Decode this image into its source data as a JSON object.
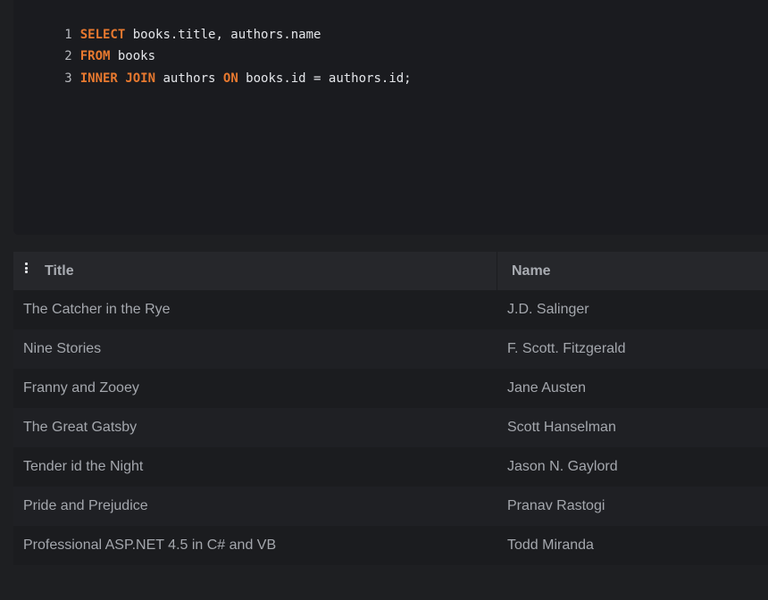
{
  "editor": {
    "lines": [
      {
        "num": "1",
        "tokens": [
          {
            "t": "SELECT",
            "kw": true
          },
          {
            "t": " books.title, authors.name",
            "kw": false
          }
        ]
      },
      {
        "num": "2",
        "tokens": [
          {
            "t": "FROM",
            "kw": true
          },
          {
            "t": " books",
            "kw": false
          }
        ]
      },
      {
        "num": "3",
        "tokens": [
          {
            "t": "INNER",
            "kw": true
          },
          {
            "t": " ",
            "kw": false
          },
          {
            "t": "JOIN",
            "kw": true
          },
          {
            "t": " authors ",
            "kw": false
          },
          {
            "t": "ON",
            "kw": true
          },
          {
            "t": " books.id = authors.id;",
            "kw": false
          }
        ]
      }
    ]
  },
  "results": {
    "menu_icon": "vertical-ellipsis-icon",
    "columns": [
      "Title",
      "Name"
    ],
    "rows": [
      [
        "The Catcher in the Rye",
        "J.D. Salinger"
      ],
      [
        "Nine Stories",
        "F. Scott. Fitzgerald"
      ],
      [
        "Franny and Zooey",
        "Jane Austen"
      ],
      [
        "The Great Gatsby",
        "Scott Hanselman"
      ],
      [
        "Tender id the Night",
        "Jason N. Gaylord"
      ],
      [
        "Pride and Prejudice",
        "Pranav Rastogi"
      ],
      [
        "Professional ASP.NET 4.5 in C# and VB",
        "Todd Miranda"
      ]
    ]
  },
  "colors": {
    "keyword": "#e8792f",
    "code_text": "#e4e6ea",
    "background": "#1e1f22"
  }
}
